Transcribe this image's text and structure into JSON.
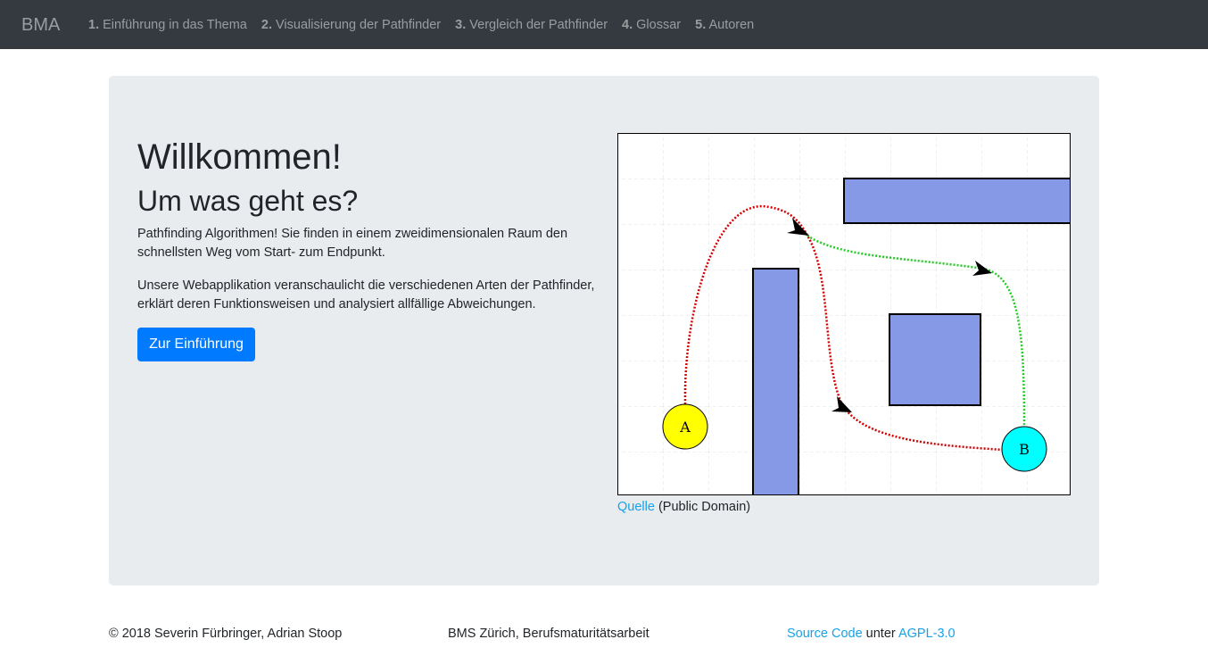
{
  "navbar": {
    "brand": "BMA",
    "items": [
      {
        "num": "1.",
        "label": "Einführung in das Thema"
      },
      {
        "num": "2.",
        "label": "Visualisierung der Pathfinder"
      },
      {
        "num": "3.",
        "label": "Vergleich der Pathfinder"
      },
      {
        "num": "4.",
        "label": "Glossar"
      },
      {
        "num": "5.",
        "label": "Autoren"
      }
    ]
  },
  "hero": {
    "title": "Willkommen!",
    "subtitle": "Um was geht es?",
    "paragraph1": "Pathfinding Algorithmen! Sie finden in einem zweidimensionalen Raum den schnellsten Weg vom Start- zum Endpunkt.",
    "paragraph2": "Unsere Webapplikation veranschaulicht die verschiedenen Arten der Pathfinder, erklärt deren Funktionsweisen und analysiert allfällige Abweichungen.",
    "button_label": "Zur Einführung"
  },
  "figure": {
    "node_a": "A",
    "node_b": "B",
    "caption_link": "Quelle",
    "caption_text": " (Public Domain)",
    "colors": {
      "obstacle": "#8599e6",
      "node_a": "#ffff00",
      "node_b": "#00ffff",
      "path_red": "#d40000",
      "path_green": "#22cc22"
    }
  },
  "footer": {
    "copyright": "© 2018 Severin Fürbringer, Adrian Stoop",
    "school": "BMS Zürich, Berufsmaturitätsarbeit",
    "source_link": "Source Code",
    "source_mid": " unter ",
    "license_link": "AGPL-3.0"
  }
}
